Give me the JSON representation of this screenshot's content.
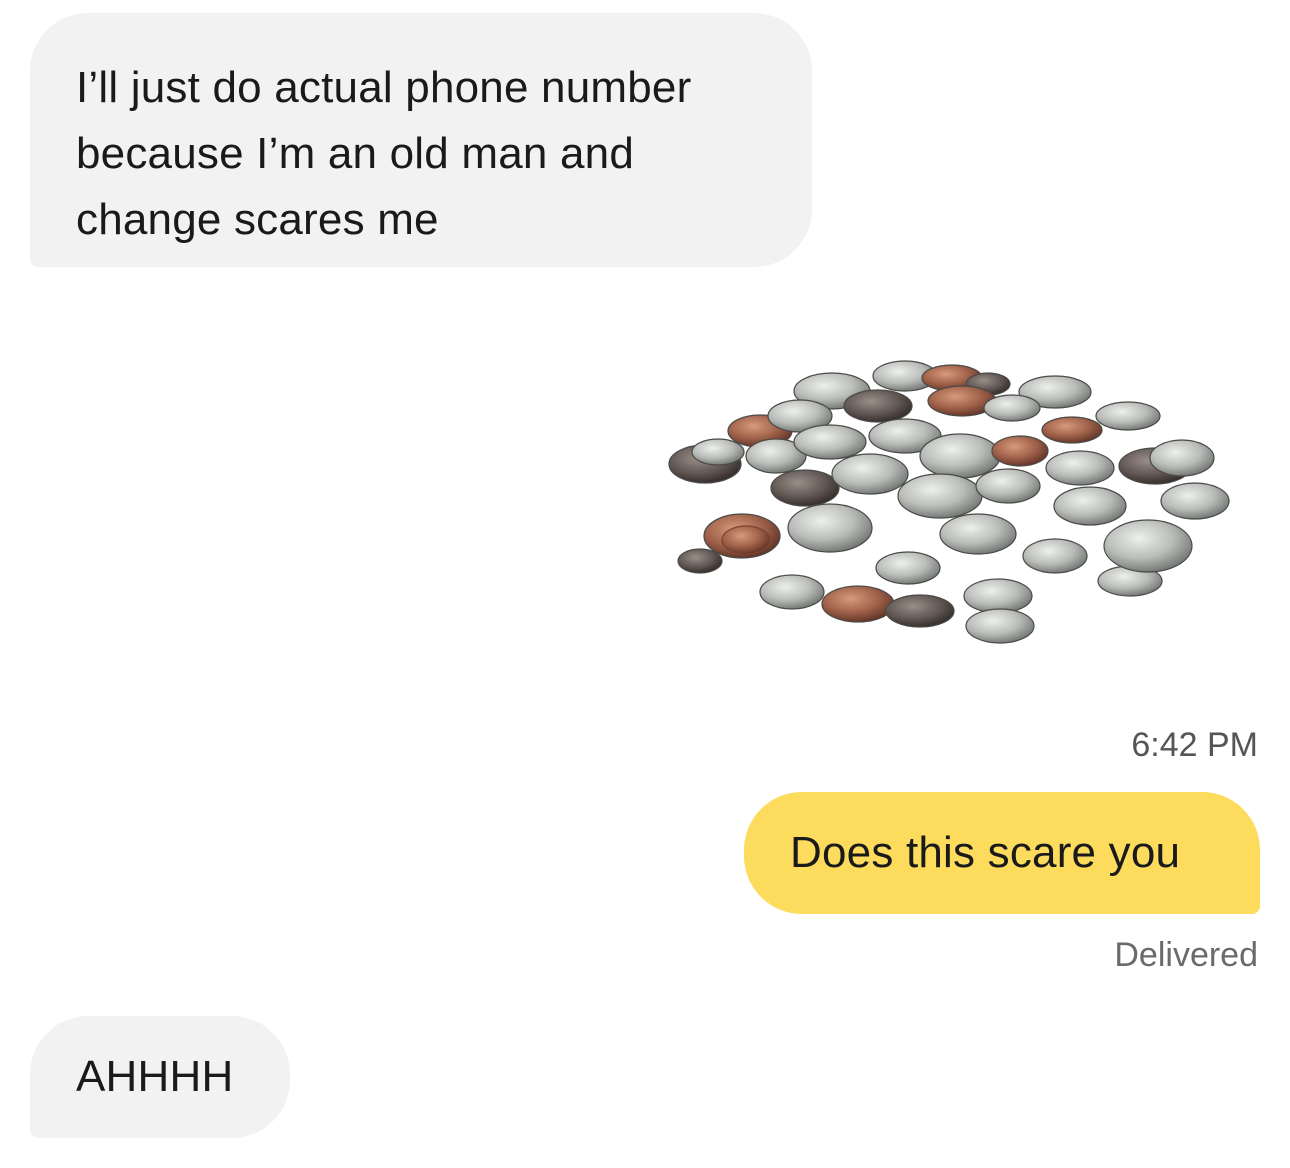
{
  "messages": [
    {
      "direction": "incoming",
      "text": "I’ll just do actual phone number\nbecause I’m an old man and\nchange scares me"
    },
    {
      "direction": "outgoing",
      "type": "image",
      "image": "pile-of-coins"
    },
    {
      "direction": "outgoing",
      "text": "Does this scare you"
    },
    {
      "direction": "incoming",
      "text": "AHHHH"
    }
  ],
  "timestamp": "6:42 PM",
  "delivery_status": "Delivered",
  "colors": {
    "incoming_bubble": "#f2f2f2",
    "outgoing_bubble": "#fcdb5d",
    "text": "#1a1a1a",
    "meta_text": "#555555"
  }
}
